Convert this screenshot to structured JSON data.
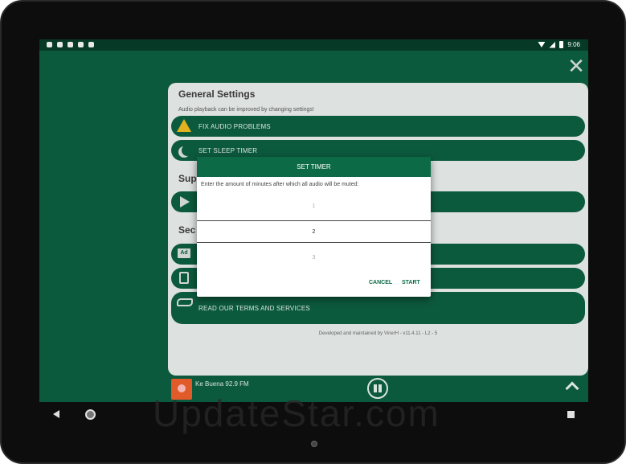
{
  "status": {
    "time": "9:06"
  },
  "panel": {
    "title": "General Settings",
    "subtitle": "Audio playback can be improved by changing settings!",
    "items": [
      {
        "label": "FIX AUDIO PROBLEMS"
      },
      {
        "label": "SET SLEEP TIMER"
      }
    ],
    "section2_title": "Sup",
    "section3_title": "Sec",
    "terms_label": "READ OUR TERMS AND SERVICES",
    "footer_note": "Developed and maintained by VinerH - v11.4.11 - L2 - 5"
  },
  "player": {
    "station": "Ke Buena 92.9 FM"
  },
  "dialog": {
    "title": "SET TIMER",
    "message": "Enter the amount of minutes after which all audio will be muted:",
    "picker": [
      "1",
      "2",
      "3"
    ],
    "cancel": "CANCEL",
    "start": "START"
  },
  "watermark": "UpdateStar.com",
  "colors": {
    "primary": "#0c5a3e",
    "dialog_header": "#0c6a47",
    "warning": "#e2b31e"
  }
}
